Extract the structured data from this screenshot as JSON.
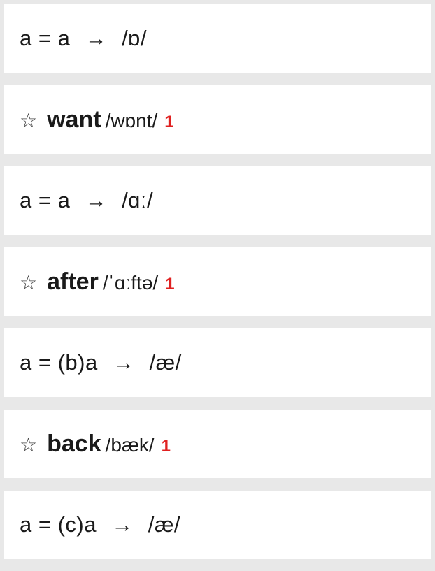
{
  "rows": [
    {
      "kind": "rule",
      "lhs": "a = a",
      "arrow": "→",
      "target": "/ɒ/"
    },
    {
      "kind": "word",
      "star": "☆",
      "word": "want",
      "ipa": "/wɒnt/",
      "badge": "1"
    },
    {
      "kind": "rule",
      "lhs": "a = a",
      "arrow": "→",
      "target": "/ɑː/"
    },
    {
      "kind": "word",
      "star": "☆",
      "word": "after",
      "ipa": "/ˈɑːftə/",
      "badge": "1"
    },
    {
      "kind": "rule",
      "lhs": "a = (b)a",
      "arrow": "→",
      "target": "/æ/"
    },
    {
      "kind": "word",
      "star": "☆",
      "word": "back",
      "ipa": "/bæk/",
      "badge": "1"
    },
    {
      "kind": "rule",
      "lhs": "a = (c)a",
      "arrow": "→",
      "target": "/æ/"
    }
  ]
}
